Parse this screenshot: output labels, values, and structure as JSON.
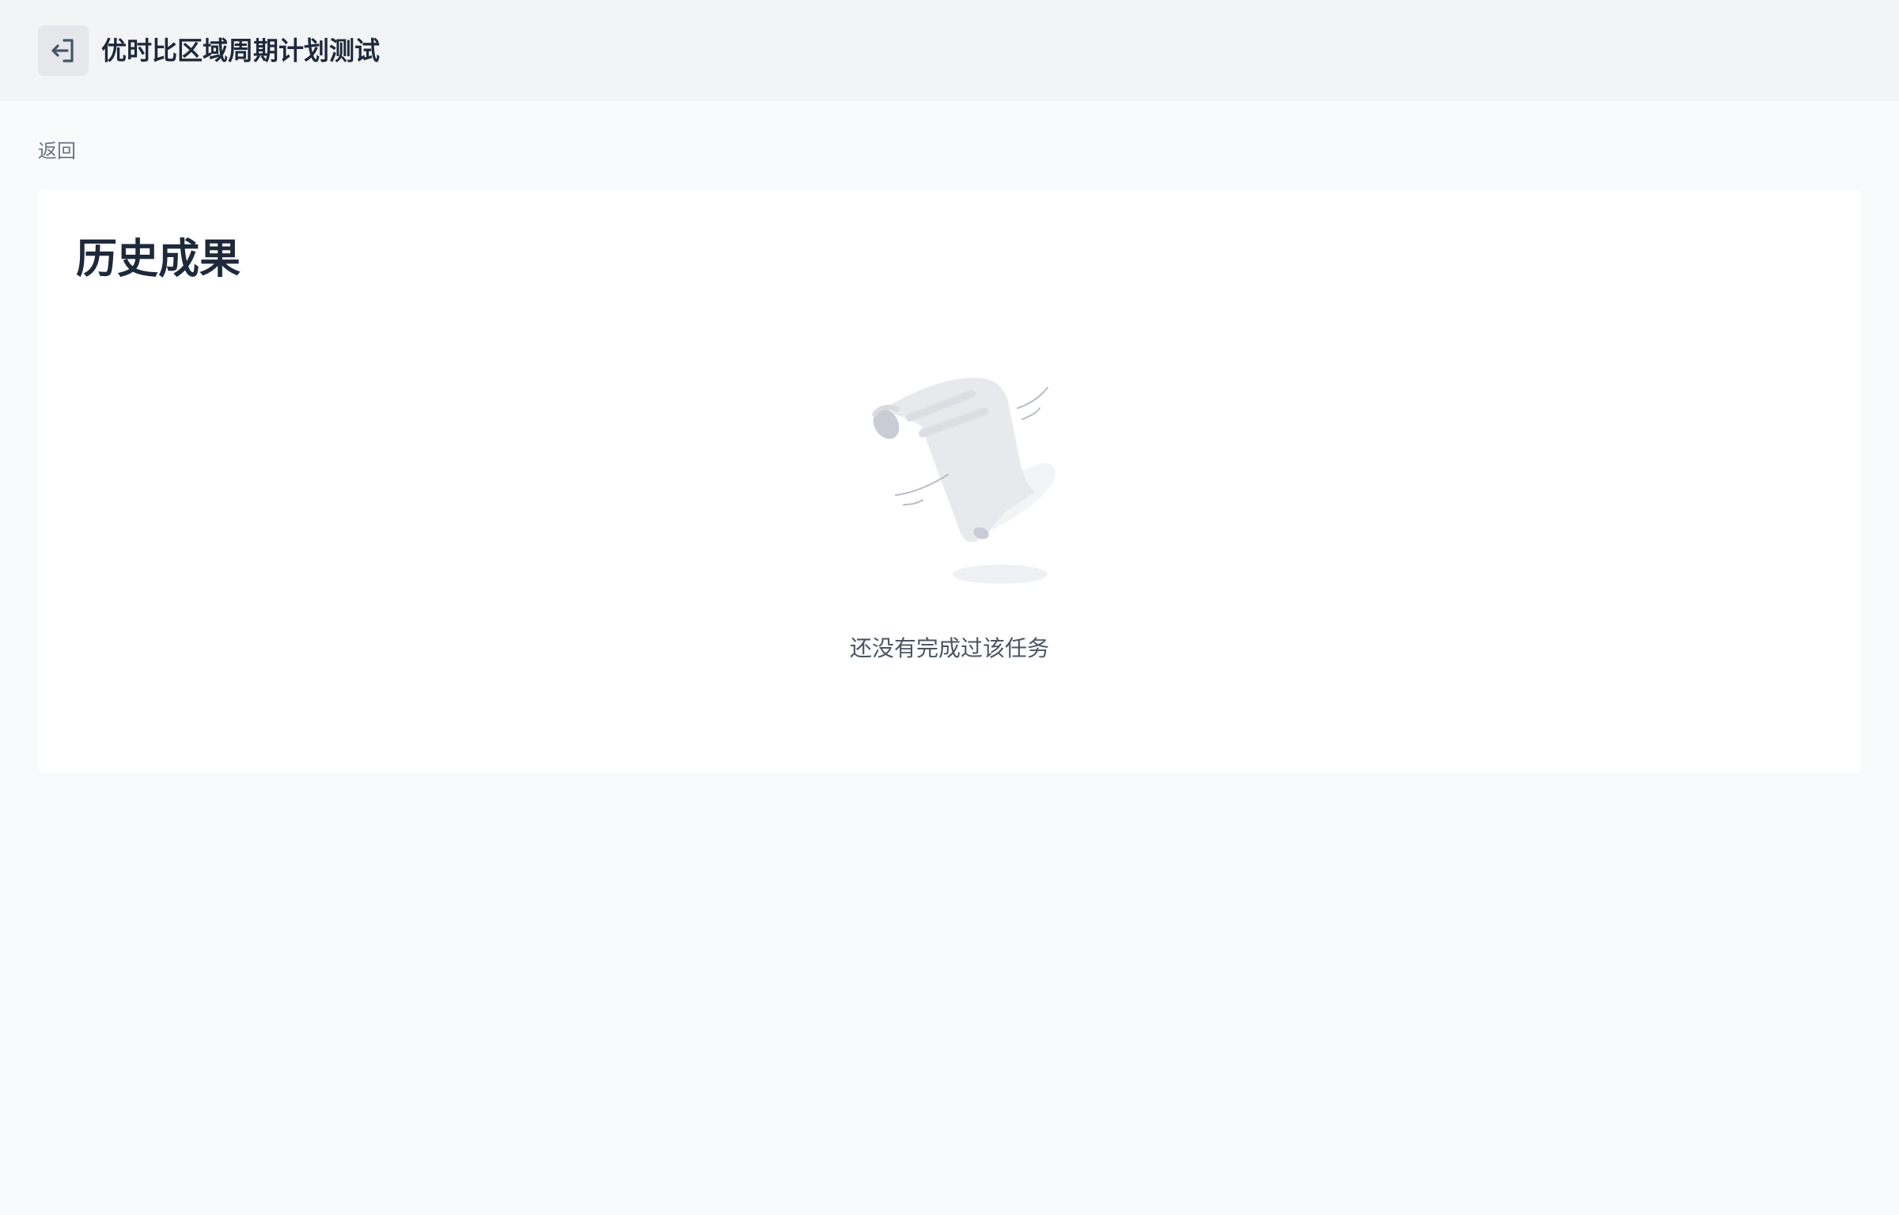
{
  "header": {
    "title": "优时比区域周期计划测试",
    "exit_icon": "exit-arrow-icon"
  },
  "navigation": {
    "back_label": "返回"
  },
  "history": {
    "title": "历史成果",
    "empty_state": {
      "illustration": "empty-scroll-illustration",
      "message": "还没有完成过该任务"
    }
  },
  "colors": {
    "page_background": "#f9fafb",
    "header_background": "#f3f4f6",
    "card_background": "#ffffff",
    "title_text": "#1e293b",
    "muted_text": "#6b7280"
  }
}
